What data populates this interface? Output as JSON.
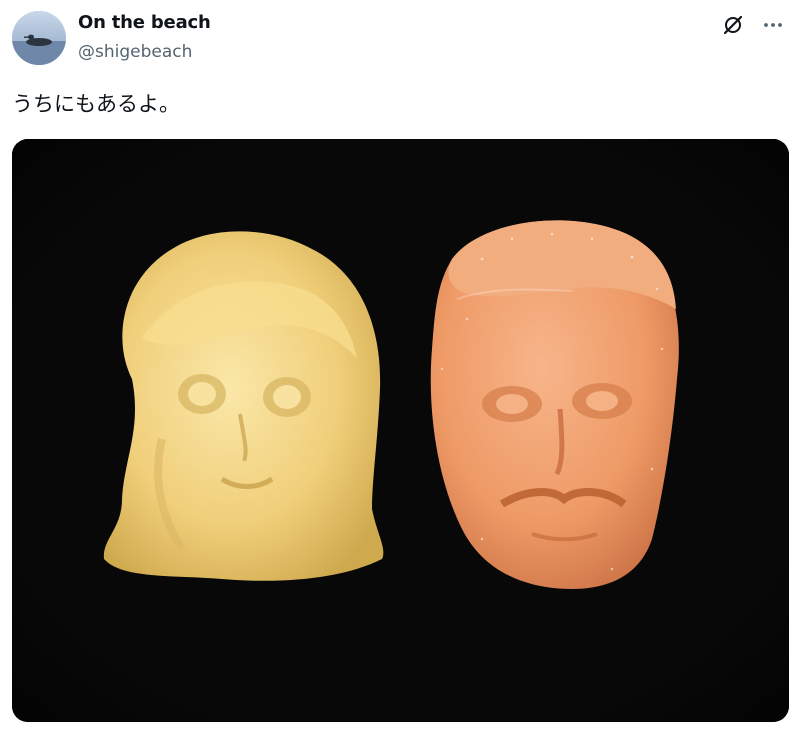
{
  "post": {
    "author": {
      "display_name": "On the beach",
      "handle": "@shigebeach"
    },
    "text": "うちにもあるよ。",
    "icons": {
      "grok": "slashed-circle-icon",
      "more": "more-horizontal-icon"
    }
  },
  "colors": {
    "text_primary": "#0f1419",
    "text_secondary": "#536471",
    "media_background": "#060606",
    "candy_yellow": "#f0cf7a",
    "candy_orange": "#f0a06d"
  }
}
